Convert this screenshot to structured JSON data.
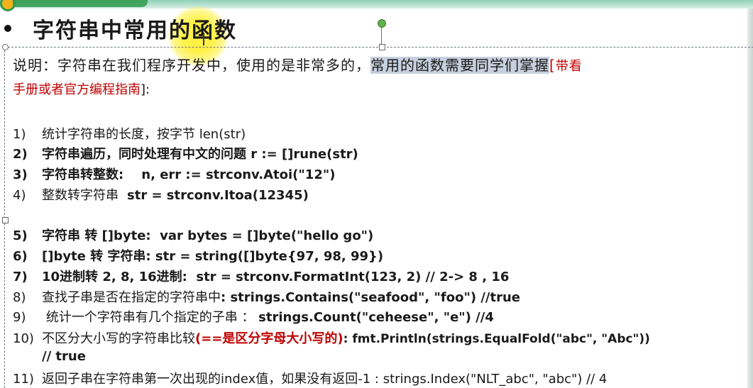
{
  "title": "字符串中常用的函数",
  "intro": {
    "text1": "说明：字符串在我们程序开发中，使用的是非常多的，",
    "selected": "常用的函数需要同学们掌握",
    "bracket_open": "[",
    "note_red_1": "带看",
    "note_red_2": "手册或者官方编程指南",
    "bracket_close": "]:"
  },
  "items": [
    {
      "num": "1)",
      "cn": "统计字符串的长度，按字节 ",
      "code": "len(str)"
    },
    {
      "num": "2)",
      "cn": "字符串遍历，同时处理有中文的问题 ",
      "code": "r := []rune(str)"
    },
    {
      "num": "3)",
      "cn": "字符串转整数:",
      "code": "    n, err := strconv.Atoi(\"12\")"
    },
    {
      "num": "4)",
      "cn": "整数转字符串 ",
      "code": " str = strconv.Itoa(12345)"
    },
    {
      "num": "5)",
      "cn": "字符串 转 ",
      "code": "[]byte:  var bytes = []byte(\"hello go\")"
    },
    {
      "num": "6)",
      "cn": "[]byte 转 字符串",
      "code": ": str = string([]byte{97, 98, 99})"
    },
    {
      "num": "7)",
      "cn": "10进制转 2, 8, 16进制",
      "code": ":  str = strconv.FormatInt(123, 2) // 2-> 8 , 16"
    },
    {
      "num": "8)",
      "cn": "查找子串是否在指定的字符串中",
      "code": ": strings.Contains(\"seafood\", \"foo\") //true"
    },
    {
      "num": "9)",
      "cn": " 统计一个字符串有几个指定的子串 ： ",
      "code": "strings.Count(\"ceheese\", \"e\") //4"
    },
    {
      "num": "10)",
      "cn": "不区分大小写的字符串比较",
      "red": "(==是区分字母大小写的)",
      "code": ": fmt.Println(strings.EqualFold(\"abc\", \"Abc\"))",
      "code2": "// true"
    },
    {
      "num": "11)",
      "cn": "返回子串在字符串第一次出现的index值，如果没有返回-1 ",
      "code": ": strings.Index(\"NLT_abc\", \"abc\") // 4"
    }
  ]
}
